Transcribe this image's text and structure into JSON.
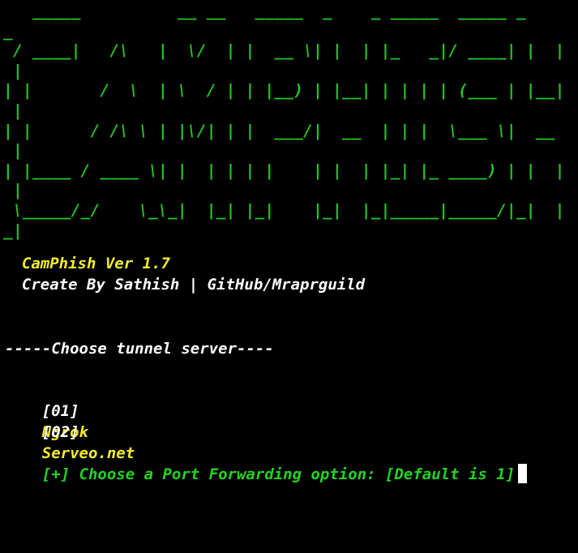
{
  "terminal": {
    "banner_lines": [
      "   _____          __ __   _____  _    _ _____  _____ _",
      "_",
      " / ____|   /\\   |  \\/  | |  __ \\| |  | |_   _|/ ____| |  |",
      " |",
      "| |       /  \\  | \\  / | | |__) | |__| | | | | (___ | |__|",
      " |",
      "| |      / /\\ \\ | |\\/| | |  ___/|  __  | | |  \\___ \\|  __",
      " |",
      "| |____ / ____ \\| |  | | | |    | |  | |_| |_ ____) | |  |",
      " |",
      " \\_____/_/    \\_\\_|  |_| |_|    |_|  |_|_____|_____/|_|  |",
      "_|"
    ],
    "app_name": "  CamPhish Ver 1.7",
    "credits": "  Create By Sathish | GitHub/Mraprguild",
    "section_header": "-----Choose tunnel server----",
    "options": [
      {
        "index": "[01]",
        "label": "Ngrok"
      },
      {
        "index": "[02]",
        "label": "Serveo.net"
      }
    ],
    "prompt": "[+] Choose a Port Forwarding option: [Default is 1]",
    "colors": {
      "background": "#000000",
      "banner": "#22c322",
      "info_text": "#f2ec2a",
      "credits_text": "#ffffff",
      "prompt_text": "#22d322",
      "cursor": "#ffffff"
    }
  }
}
